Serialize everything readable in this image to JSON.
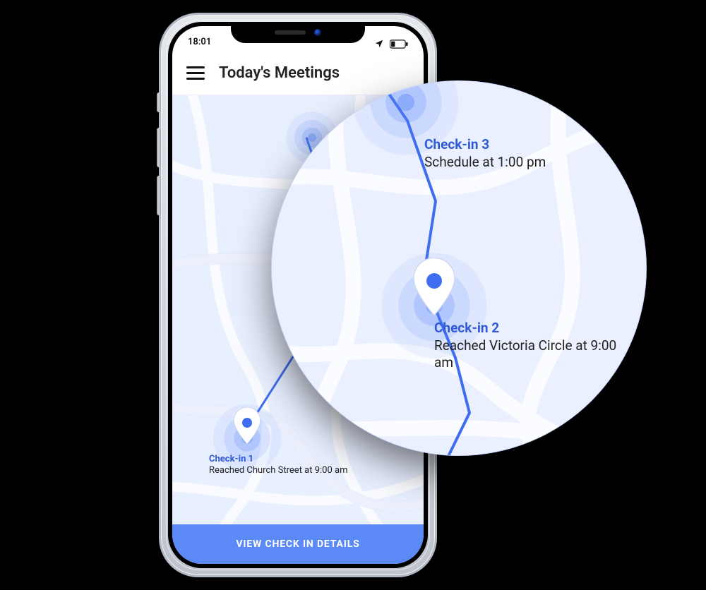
{
  "statusbar": {
    "time": "18:01"
  },
  "header": {
    "title": "Today's Meetings"
  },
  "bottom_button_label": "VIEW CHECK IN DETAILS",
  "colors": {
    "brand": "#3f6df0",
    "button": "#5b89f5",
    "map_background": "#e8efff"
  },
  "checkins": [
    {
      "id": 1,
      "title": "Check-in 1",
      "subtitle": "Reached Church Street at 9:00 am"
    },
    {
      "id": 2,
      "title": "Check-in 2",
      "subtitle": "Reached Victoria Circle at 9:00 am"
    },
    {
      "id": 3,
      "title": "Check-in 3",
      "subtitle": "Schedule at 1:00 pm"
    }
  ],
  "lens_checkins": [
    {
      "ref": 3,
      "title": "Check-in 3",
      "subtitle": "Schedule at 1:00 pm"
    },
    {
      "ref": 2,
      "title": "Check-in 2",
      "subtitle": "Reached Victoria Circle at 9:00 am"
    }
  ],
  "icons": {
    "location": "location-arrow-icon",
    "battery": "battery-icon",
    "menu": "hamburger-icon",
    "pin": "map-pin-icon"
  }
}
